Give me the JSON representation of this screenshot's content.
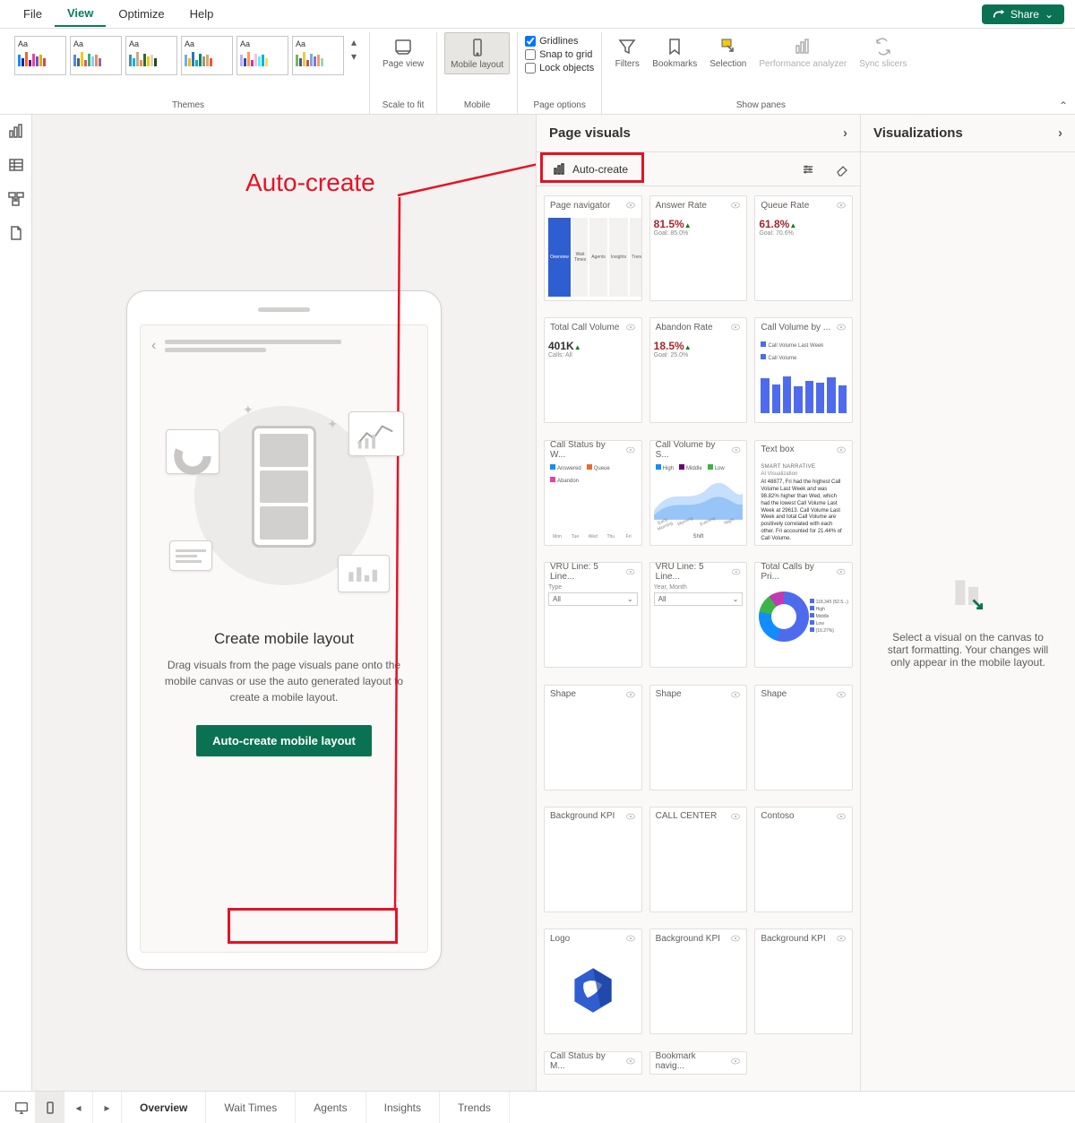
{
  "menubar": {
    "items": [
      "File",
      "View",
      "Optimize",
      "Help"
    ],
    "active": "View",
    "share": "Share"
  },
  "ribbon": {
    "themes_label": "Themes",
    "page_view": "Page view",
    "scale_label": "Scale to fit",
    "mobile_layout": "Mobile layout",
    "mobile_label": "Mobile",
    "gridlines": "Gridlines",
    "snap": "Snap to grid",
    "lock": "Lock objects",
    "page_options": "Page options",
    "filters": "Filters",
    "bookmarks": "Bookmarks",
    "selection": "Selection",
    "perf": "Performance analyzer",
    "sync": "Sync slicers",
    "show_panes": "Show panes"
  },
  "annotation": "Auto-create",
  "phone": {
    "title": "Create mobile layout",
    "desc": "Drag visuals from the page visuals pane onto the mobile canvas or use the auto generated layout to create a mobile layout.",
    "button": "Auto-create mobile layout"
  },
  "page_visuals": {
    "title": "Page visuals",
    "auto": "Auto-create",
    "cards": [
      {
        "title": "Page navigator",
        "type": "nav",
        "items": [
          "Overview",
          "Wait Times",
          "Agents",
          "Insights",
          "Trends"
        ]
      },
      {
        "title": "Answer Rate",
        "type": "kpi",
        "value": "81.5%",
        "sub": "Goal: 85.0%",
        "color": "#a4262c"
      },
      {
        "title": "Queue Rate",
        "type": "kpi",
        "value": "61.8%",
        "sub": "Goal: 70.6%",
        "color": "#a4262c"
      },
      {
        "title": "Total Call Volume",
        "type": "kpi",
        "value": "401K",
        "sub": "Calls: All",
        "color": "#323130"
      },
      {
        "title": "Abandon Rate",
        "type": "kpi",
        "value": "18.5%",
        "sub": "Goal: 25.0%",
        "color": "#a4262c"
      },
      {
        "title": "Call Volume by ...",
        "type": "bars",
        "legend": [
          "Call Volume Last Week",
          "Call Volume"
        ],
        "values": [
          75,
          62,
          80,
          58,
          70,
          66,
          78,
          60
        ]
      },
      {
        "title": "Call Status by W...",
        "type": "grouped",
        "legend": [
          "Answered",
          "Queue",
          "Abandon"
        ],
        "labels": [
          "Mon",
          "Tue",
          "Wed",
          "Thu",
          "Fri"
        ]
      },
      {
        "title": "Call Volume by S...",
        "type": "area",
        "legend": [
          "High",
          "Middle",
          "Low"
        ],
        "labels": [
          "Early Morning",
          "Morning",
          "Evening",
          "Night"
        ]
      },
      {
        "title": "Text box",
        "type": "text",
        "header": "SMART NARRATIVE",
        "body": "At 48877, Fri had the highest Call Volume Last Week and was 98.82% higher than Wed, which had the lowest Call Volume Last Week at 29613. Call Volume Last Week and total Call Volume are positively correlated with each other. Fri accounted for 21.44% of Call Volume."
      },
      {
        "title": "VRU Line: 5 Line...",
        "type": "dropdown",
        "label": "Type",
        "value": "All"
      },
      {
        "title": "VRU Line: 5 Line...",
        "type": "dropdown",
        "label": "Year, Month",
        "value": "All"
      },
      {
        "title": "Total Calls by Pri...",
        "type": "donut",
        "segments": [
          "118,345 (52.5...)",
          "High",
          "Middle",
          "Low",
          "(16.27%)"
        ]
      },
      {
        "title": "Shape",
        "type": "blank"
      },
      {
        "title": "Shape",
        "type": "blank"
      },
      {
        "title": "Shape",
        "type": "blank"
      },
      {
        "title": "Background KPI",
        "type": "blank"
      },
      {
        "title": "CALL CENTER",
        "type": "blank"
      },
      {
        "title": "Contoso",
        "type": "blank"
      },
      {
        "title": "Logo",
        "type": "logo"
      },
      {
        "title": "Background KPI",
        "type": "blank"
      },
      {
        "title": "Background KPI",
        "type": "blank"
      },
      {
        "title": "Call Status by M...",
        "type": "last"
      },
      {
        "title": "Bookmark navig...",
        "type": "last"
      }
    ]
  },
  "visualizations": {
    "title": "Visualizations",
    "placeholder": "Select a visual on the canvas to start formatting. Your changes will only appear in the mobile layout."
  },
  "page_tabs": [
    "Overview",
    "Wait Times",
    "Agents",
    "Insights",
    "Trends"
  ],
  "active_page": "Overview"
}
